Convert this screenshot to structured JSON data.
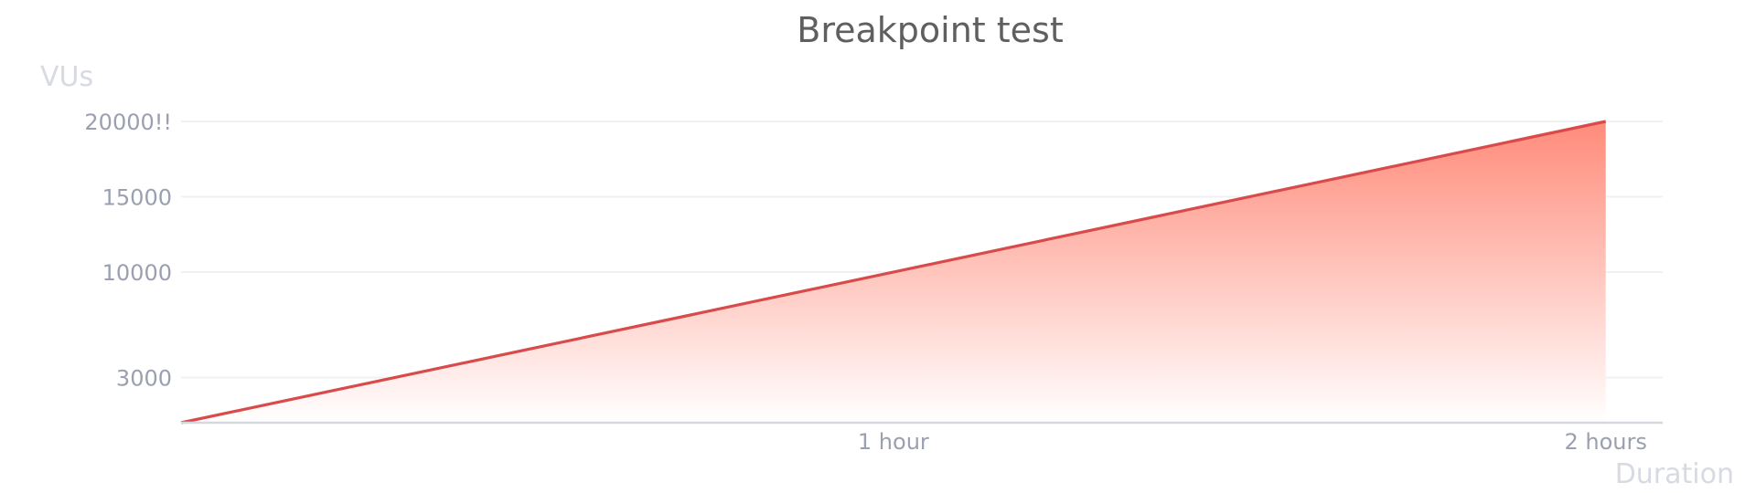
{
  "chart_data": {
    "type": "area",
    "title": "Breakpoint test",
    "ylabel": "VUs",
    "xlabel": "Duration",
    "x_unit": "hours",
    "x": [
      0,
      2
    ],
    "series": [
      {
        "values": [
          0,
          20000
        ]
      }
    ],
    "xlim": [
      0,
      2.08
    ],
    "ylim": [
      0,
      20000
    ],
    "y_ticks": [
      {
        "value": 3000,
        "label": "3000"
      },
      {
        "value": 10000,
        "label": "10000"
      },
      {
        "value": 15000,
        "label": "15000"
      },
      {
        "value": 20000,
        "label": "20000!!"
      }
    ],
    "x_ticks": [
      {
        "value": 1,
        "label": "1 hour"
      },
      {
        "value": 2,
        "label": "2 hours"
      }
    ],
    "grid": true,
    "colors": {
      "line": "#d94a4a",
      "fill_top": "#ff8b7a",
      "fill_bottom": "#ffffff",
      "title": "#5f5f5f",
      "axis_name": "#d7dae3",
      "tick_label": "#9aa0b0",
      "grid": "#f0f1f4",
      "baseline": "#d4d7de"
    }
  }
}
